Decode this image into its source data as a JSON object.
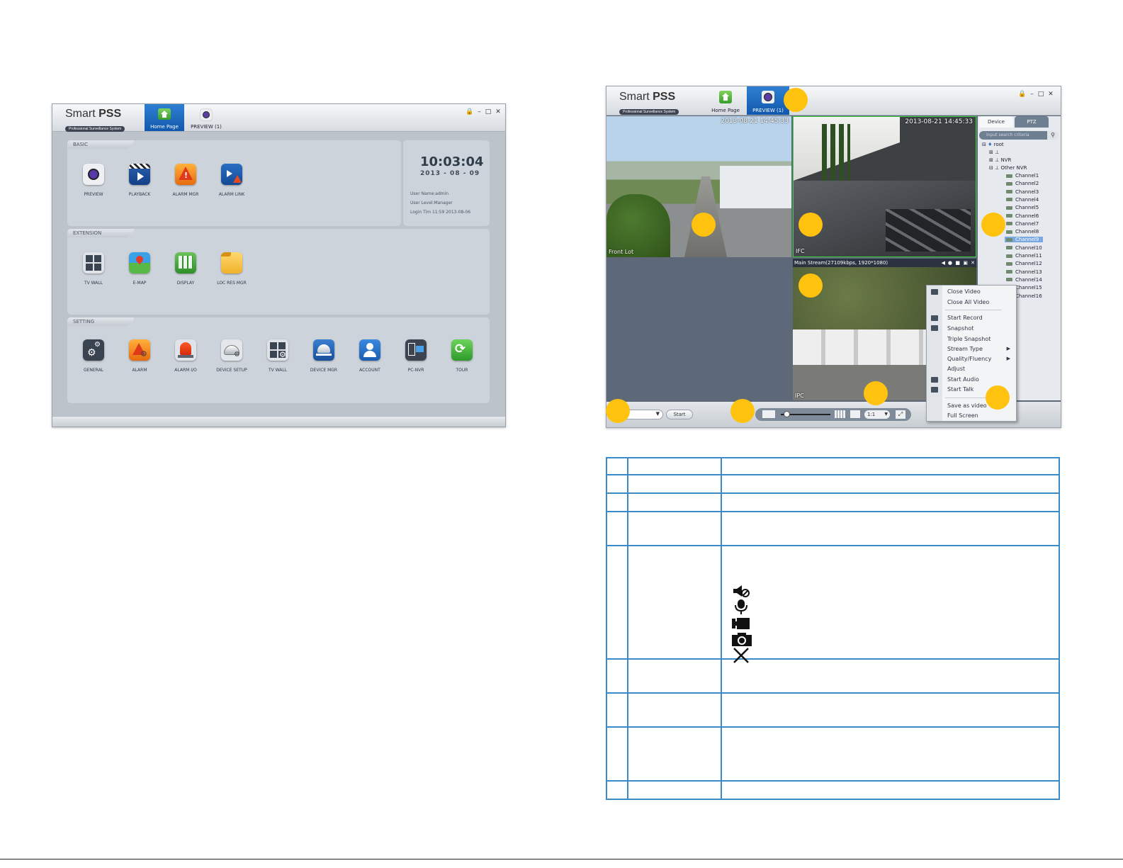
{
  "left_window": {
    "app_name_1": "Smart",
    "app_name_2": "PSS",
    "app_subtitle": "Professional Surveillance System",
    "tabs": [
      {
        "label": "Home Page",
        "icon": "home-icon",
        "active": true
      },
      {
        "label": "PREVIEW (1)",
        "icon": "preview-camera-icon",
        "active": false
      }
    ],
    "window_controls": [
      "lock-icon",
      "minimize-icon",
      "maximize-icon",
      "close-icon"
    ],
    "basic": {
      "title": "BASIC",
      "items": [
        {
          "label": "PREVIEW",
          "icon": "preview-camera-icon"
        },
        {
          "label": "PLAYBACK",
          "icon": "playback-clapper-icon"
        },
        {
          "label": "ALARM MGR",
          "icon": "alarm-warning-icon"
        },
        {
          "label": "ALARM LINK",
          "icon": "alarm-link-icon"
        }
      ]
    },
    "clock": {
      "time": "10:03:04",
      "date": "2013 - 08 - 09",
      "user_name": "User Name:admin",
      "user_level": "User Level:Manager",
      "login_time": "Login Tim 11:59 2013-08-06"
    },
    "extension": {
      "title": "EXTENSION",
      "items": [
        {
          "label": "TV WALL",
          "icon": "tv-wall-icon"
        },
        {
          "label": "E-MAP",
          "icon": "emap-pin-icon"
        },
        {
          "label": "DISPLAY",
          "icon": "display-grid-icon"
        },
        {
          "label": "LOC RES MGR",
          "icon": "folder-icon"
        }
      ]
    },
    "setting": {
      "title": "SETTING",
      "items": [
        {
          "label": "GENERAL",
          "icon": "gears-icon"
        },
        {
          "label": "ALARM",
          "icon": "alarm-settings-icon"
        },
        {
          "label": "ALARM I/O",
          "icon": "alarm-siren-icon"
        },
        {
          "label": "DEVICE SETUP",
          "icon": "dome-camera-settings-icon"
        },
        {
          "label": "TV WALL",
          "icon": "tv-wall-settings-icon"
        },
        {
          "label": "DEVICE MGR",
          "icon": "device-manager-icon"
        },
        {
          "label": "ACCOUNT",
          "icon": "account-user-icon"
        },
        {
          "label": "PC-NVR",
          "icon": "pc-nvr-icon"
        },
        {
          "label": "TOUR",
          "icon": "tour-refresh-icon"
        }
      ]
    }
  },
  "right_window": {
    "app_name_1": "Smart",
    "app_name_2": "PSS",
    "app_subtitle": "Professional Surveillance System",
    "tabs": [
      {
        "label": "Home Page",
        "icon": "home-icon",
        "active": false
      },
      {
        "label": "PREVIEW (1)",
        "icon": "preview-camera-icon",
        "active": true
      }
    ],
    "video_1": {
      "label": "Front Lot",
      "timestamp": "2013-08-21 14:45:33"
    },
    "video_2": {
      "label": "IFC",
      "timestamp": "2013-08-21 14:45:33"
    },
    "video_4": {
      "stream_info": "Main Stream(27109kbps, 1920*1080)",
      "label": "IPC"
    },
    "panel_tabs": [
      "Device",
      "PTZ"
    ],
    "search_placeholder": "Input search criteria",
    "tree": {
      "root": "root",
      "nodes": [
        "NVR",
        "Other NVR"
      ],
      "channels": [
        "Channel1",
        "Channel2",
        "Channel3",
        "Channel4",
        "Channel5",
        "Channel6",
        "Channel7",
        "Channel8",
        "Channel9",
        "Channel10",
        "Channel11",
        "Channel12",
        "Channel13",
        "Channel14",
        "Channel15",
        "Channel16"
      ],
      "selected": "Channel9"
    },
    "context_menu": {
      "group1": [
        "Close Video",
        "Close All Video"
      ],
      "group2": [
        "Start Record",
        "Snapshot",
        "Triple Snapshot",
        "Stream Type",
        "Quality/Fluency",
        "Adjust",
        "Start Audio",
        "Start Talk"
      ],
      "group3": [
        "Save as video",
        "Full Screen"
      ]
    },
    "bottom": {
      "start_button": "Start",
      "ratio": "1:1"
    }
  },
  "reference_icons": [
    "mute-audio-icon",
    "microphone-icon",
    "record-video-icon",
    "snapshot-camera-icon",
    "close-x-icon"
  ],
  "colors": {
    "accent_blue": "#1a6fc6",
    "callout_yellow": "#ffc20e",
    "table_border": "#3b8bc8",
    "panel_gray": "#cdd3da"
  }
}
